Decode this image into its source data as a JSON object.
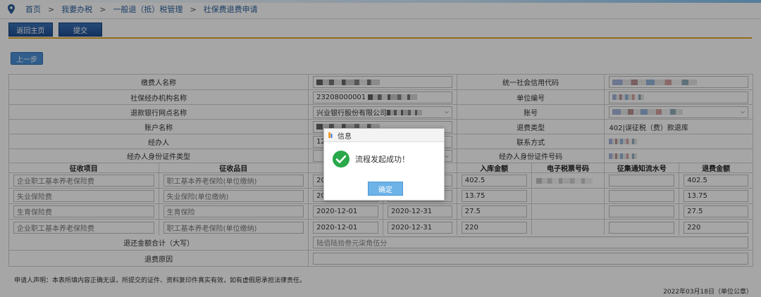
{
  "breadcrumb": [
    "首页",
    "我要办税",
    "一般退（抵）税管理",
    "社保费退费申请"
  ],
  "breadcrumb_sep": ">",
  "toolbar": {
    "home": "返回主页",
    "submit": "提交"
  },
  "prev_button": "上一步",
  "form": {
    "payer_name_label": "缴费人名称",
    "credit_code_label": "统一社会信用代码",
    "agency_label": "社保经办机构名称",
    "agency_value": "23208000001",
    "unit_no_label": "单位编号",
    "bank_label": "退款银行网点名称",
    "bank_value": "兴业银行股份有限公司",
    "account_no_label": "账号",
    "account_name_label": "账户名称",
    "refund_type_label": "退费类型",
    "refund_type_value": "402|误征税（费）款退库",
    "handler_label": "经办人",
    "handler_value_prefix": "12",
    "contact_label": "联系方式",
    "id_type_label": "经办人身份证件类型",
    "id_no_label": "经办人身份证件号码"
  },
  "table": {
    "headers": [
      "征收项目",
      "征收品目",
      "",
      "",
      "入库金额",
      "电子税票号码",
      "征集通知流水号",
      "退费金额"
    ],
    "rows": [
      {
        "item": "企业职工基本养老保险费",
        "sub": "职工基本养老保险(单位缴纳)",
        "start": "20",
        "end": "",
        "amount": "402.5",
        "refund": "402.5"
      },
      {
        "item": "失业保险费",
        "sub": "失业保险(单位缴纳)",
        "start": "20",
        "end": "",
        "amount": "13.75",
        "refund": "13.75"
      },
      {
        "item": "生育保险费",
        "sub": "生育保险",
        "start": "2020-12-01",
        "end": "2020-12-31",
        "amount": "27.5",
        "refund": "27.5"
      },
      {
        "item": "企业职工基本养老保险费",
        "sub": "职工基本养老保险(单位缴纳)",
        "start": "2020-12-01",
        "end": "2020-12-31",
        "amount": "220",
        "refund": "220"
      }
    ]
  },
  "total_label": "退还金额合计（大写）",
  "total_value": "陆佰陆拾叁元柒角伍分",
  "reason_label": "退费原因",
  "statement": "申请人声明：本表所填内容正确无误，所提交的证件、资料复印件真实有效，如有虚假愿承担法律责任。",
  "date_line": "2022年03月18日（单位公章）",
  "dialog": {
    "title": "信息",
    "message": "流程发起成功！",
    "ok": "确定"
  },
  "colors": {
    "accent": "#1f4e92",
    "gold": "#e3a72a",
    "success": "#2aa84a",
    "dialog_button": "#6db3e8"
  }
}
